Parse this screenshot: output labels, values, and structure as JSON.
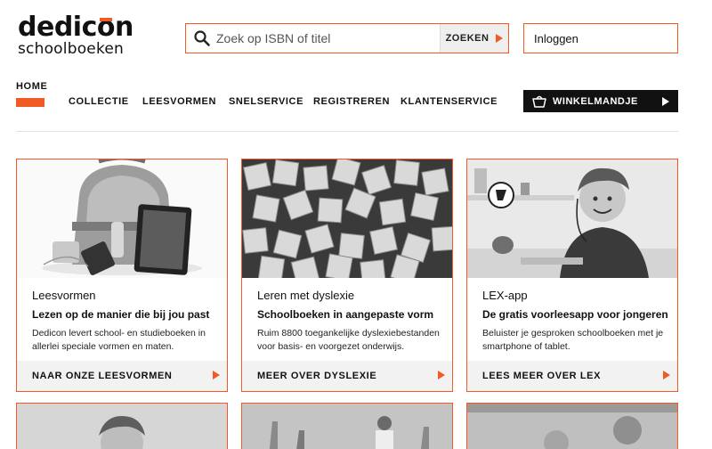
{
  "logo": {
    "line1_part1": "dedic",
    "line1_part2": "o",
    "line1_part3": "n",
    "line2": "schoolboeken"
  },
  "search": {
    "placeholder": "Zoek op ISBN of titel",
    "value": "",
    "button_label": "ZOEKEN"
  },
  "login": {
    "label": "Inloggen"
  },
  "nav": {
    "items": [
      {
        "label": "HOME",
        "active": true
      },
      {
        "label": "COLLECTIE"
      },
      {
        "label": "LEESVORMEN"
      },
      {
        "label": "SNELSERVICE"
      },
      {
        "label": "REGISTREREN"
      },
      {
        "label": "KLANTENSERVICE"
      }
    ],
    "cart_label": "WINKELMANDJE"
  },
  "cards": [
    {
      "title": "Leesvormen",
      "subtitle": "Lezen op de manier die bij jou past",
      "description": "Dedicon levert school- en studieboeken in allerlei speciale vormen en maten.",
      "link": "NAAR ONZE LEESVORMEN"
    },
    {
      "title": "Leren met dyslexie",
      "subtitle": "Schoolboeken in aangepaste vorm",
      "description": "Ruim 8800 toegankelijke dyslexiebestanden voor basis- en voorgezet onderwijs.",
      "link": "MEER OVER DYSLEXIE"
    },
    {
      "title": "LEX-app",
      "subtitle": "De gratis voorleesapp voor jongeren",
      "description": "Beluister je gesproken schoolboeken met je smartphone of tablet.",
      "link": "LEES MEER OVER LEX"
    }
  ],
  "colors": {
    "accent": "#f15a22",
    "dark": "#111111",
    "link_bg": "#f2f2f2"
  },
  "icons": {
    "search": "search-icon",
    "cart": "shopping-basket-icon",
    "arrow": "play-triangle-icon"
  }
}
